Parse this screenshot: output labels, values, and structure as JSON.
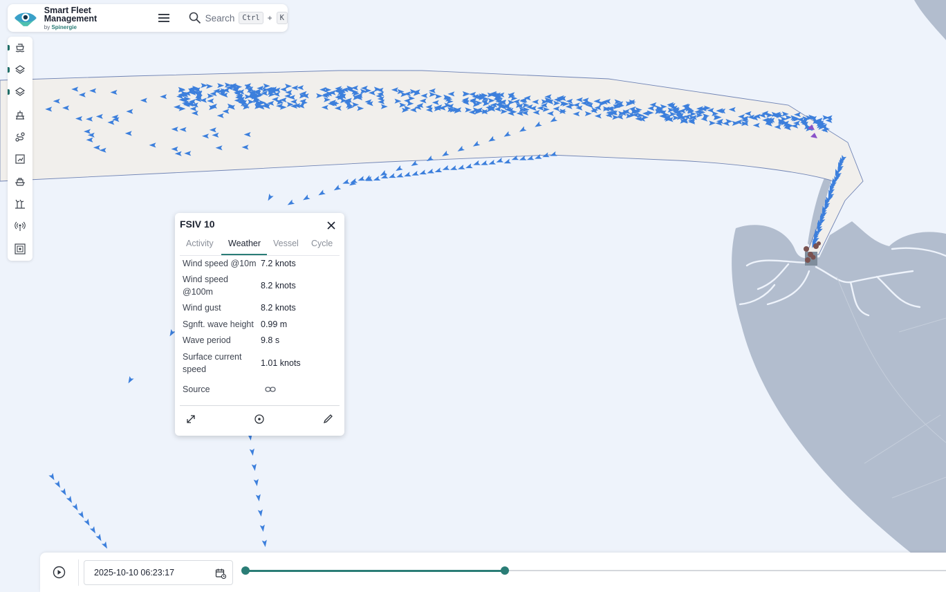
{
  "app": {
    "title": "Smart Fleet Management",
    "by_prefix": "by",
    "by_brand": "Spinergie",
    "accent": "#2a7d76"
  },
  "search": {
    "label": "Search",
    "key1": "Ctrl",
    "plus": "+",
    "key2": "K"
  },
  "sidebar": {
    "items": [
      {
        "icon": "vessel-icon"
      },
      {
        "icon": "layers-icon"
      },
      {
        "icon": "layers-stack-icon"
      },
      {
        "icon": "platform-icon"
      },
      {
        "icon": "route-icon"
      },
      {
        "icon": "zone-icon"
      },
      {
        "icon": "ship-icon"
      },
      {
        "icon": "wind-farm-icon"
      },
      {
        "icon": "signal-icon"
      },
      {
        "icon": "grid-icon"
      }
    ]
  },
  "map": {
    "water": "#eef3fb",
    "land": "#b2bdce",
    "channel": "#f1efec",
    "vessel": "#3c7fdc"
  },
  "popup": {
    "title": "FSIV 10",
    "tabs": [
      "Activity",
      "Weather",
      "Vessel",
      "Cycle"
    ],
    "active_tab": "Weather",
    "rows": [
      {
        "label": "Wind speed @10m",
        "value": "7.2 knots"
      },
      {
        "label": "Wind speed",
        "label2": "@100m",
        "value": "8.2 knots"
      },
      {
        "label": "Wind gust",
        "value": "8.2 knots"
      },
      {
        "label": "Sgnft. wave height",
        "value": "0.99 m"
      },
      {
        "label": "Wave period",
        "value": "9.8 s"
      },
      {
        "label": "Surface current",
        "label2": "speed",
        "value": "1.01 knots"
      },
      {
        "label": "Source",
        "value": ""
      }
    ]
  },
  "timeline": {
    "datetime": "2025-10-10 06:23:17",
    "range_start": 0.0,
    "range_end": 0.37
  }
}
